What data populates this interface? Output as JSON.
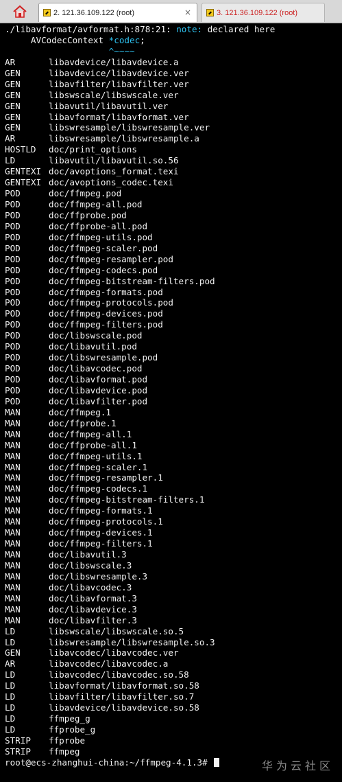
{
  "tabs": [
    {
      "label": "2. 121.36.109.122 (root)",
      "active": true,
      "text_color": "#222222"
    },
    {
      "label": "3. 121.36.109.122 (root)",
      "active": false,
      "text_color": "#cc2222"
    }
  ],
  "tab_icon": "terminal-session-icon",
  "home_icon": "home-icon",
  "close_glyph": "×",
  "terminal": {
    "header_lines": [
      {
        "prefix": "./libavformat/avformat.h:878:21: ",
        "note": "note:",
        "suffix": " declared here"
      },
      {
        "prefix": "     AVCodecContext ",
        "note": "*codec",
        "suffix": ";"
      },
      {
        "prefix": "                    ",
        "note": "^~~~~",
        "suffix": ""
      }
    ],
    "build_lines": [
      [
        "AR",
        "libavdevice/libavdevice.a"
      ],
      [
        "GEN",
        "libavdevice/libavdevice.ver"
      ],
      [
        "GEN",
        "libavfilter/libavfilter.ver"
      ],
      [
        "GEN",
        "libswscale/libswscale.ver"
      ],
      [
        "GEN",
        "libavutil/libavutil.ver"
      ],
      [
        "GEN",
        "libavformat/libavformat.ver"
      ],
      [
        "GEN",
        "libswresample/libswresample.ver"
      ],
      [
        "AR",
        "libswresample/libswresample.a"
      ],
      [
        "HOSTLD",
        "doc/print_options"
      ],
      [
        "LD",
        "libavutil/libavutil.so.56"
      ],
      [
        "GENTEXI",
        "doc/avoptions_format.texi"
      ],
      [
        "GENTEXI",
        "doc/avoptions_codec.texi"
      ],
      [
        "POD",
        "doc/ffmpeg.pod"
      ],
      [
        "POD",
        "doc/ffmpeg-all.pod"
      ],
      [
        "POD",
        "doc/ffprobe.pod"
      ],
      [
        "POD",
        "doc/ffprobe-all.pod"
      ],
      [
        "POD",
        "doc/ffmpeg-utils.pod"
      ],
      [
        "POD",
        "doc/ffmpeg-scaler.pod"
      ],
      [
        "POD",
        "doc/ffmpeg-resampler.pod"
      ],
      [
        "POD",
        "doc/ffmpeg-codecs.pod"
      ],
      [
        "POD",
        "doc/ffmpeg-bitstream-filters.pod"
      ],
      [
        "POD",
        "doc/ffmpeg-formats.pod"
      ],
      [
        "POD",
        "doc/ffmpeg-protocols.pod"
      ],
      [
        "POD",
        "doc/ffmpeg-devices.pod"
      ],
      [
        "POD",
        "doc/ffmpeg-filters.pod"
      ],
      [
        "POD",
        "doc/libswscale.pod"
      ],
      [
        "POD",
        "doc/libavutil.pod"
      ],
      [
        "POD",
        "doc/libswresample.pod"
      ],
      [
        "POD",
        "doc/libavcodec.pod"
      ],
      [
        "POD",
        "doc/libavformat.pod"
      ],
      [
        "POD",
        "doc/libavdevice.pod"
      ],
      [
        "POD",
        "doc/libavfilter.pod"
      ],
      [
        "MAN",
        "doc/ffmpeg.1"
      ],
      [
        "MAN",
        "doc/ffprobe.1"
      ],
      [
        "MAN",
        "doc/ffmpeg-all.1"
      ],
      [
        "MAN",
        "doc/ffprobe-all.1"
      ],
      [
        "MAN",
        "doc/ffmpeg-utils.1"
      ],
      [
        "MAN",
        "doc/ffmpeg-scaler.1"
      ],
      [
        "MAN",
        "doc/ffmpeg-resampler.1"
      ],
      [
        "MAN",
        "doc/ffmpeg-codecs.1"
      ],
      [
        "MAN",
        "doc/ffmpeg-bitstream-filters.1"
      ],
      [
        "MAN",
        "doc/ffmpeg-formats.1"
      ],
      [
        "MAN",
        "doc/ffmpeg-protocols.1"
      ],
      [
        "MAN",
        "doc/ffmpeg-devices.1"
      ],
      [
        "MAN",
        "doc/ffmpeg-filters.1"
      ],
      [
        "MAN",
        "doc/libavutil.3"
      ],
      [
        "MAN",
        "doc/libswscale.3"
      ],
      [
        "MAN",
        "doc/libswresample.3"
      ],
      [
        "MAN",
        "doc/libavcodec.3"
      ],
      [
        "MAN",
        "doc/libavformat.3"
      ],
      [
        "MAN",
        "doc/libavdevice.3"
      ],
      [
        "MAN",
        "doc/libavfilter.3"
      ],
      [
        "LD",
        "libswscale/libswscale.so.5"
      ],
      [
        "LD",
        "libswresample/libswresample.so.3"
      ],
      [
        "GEN",
        "libavcodec/libavcodec.ver"
      ],
      [
        "AR",
        "libavcodec/libavcodec.a"
      ],
      [
        "LD",
        "libavcodec/libavcodec.so.58"
      ],
      [
        "LD",
        "libavformat/libavformat.so.58"
      ],
      [
        "LD",
        "libavfilter/libavfilter.so.7"
      ],
      [
        "LD",
        "libavdevice/libavdevice.so.58"
      ],
      [
        "LD",
        "ffmpeg_g"
      ],
      [
        "LD",
        "ffprobe_g"
      ],
      [
        "STRIP",
        "ffprobe"
      ],
      [
        "STRIP",
        "ffmpeg"
      ]
    ],
    "prompt": "root@ecs-zhanghui-china:~/ffmpeg-4.1.3# ",
    "watermark": "华为云社区",
    "colors": {
      "background": "#000000",
      "foreground": "#f2f2f2",
      "note": "#2ec2f0"
    }
  }
}
